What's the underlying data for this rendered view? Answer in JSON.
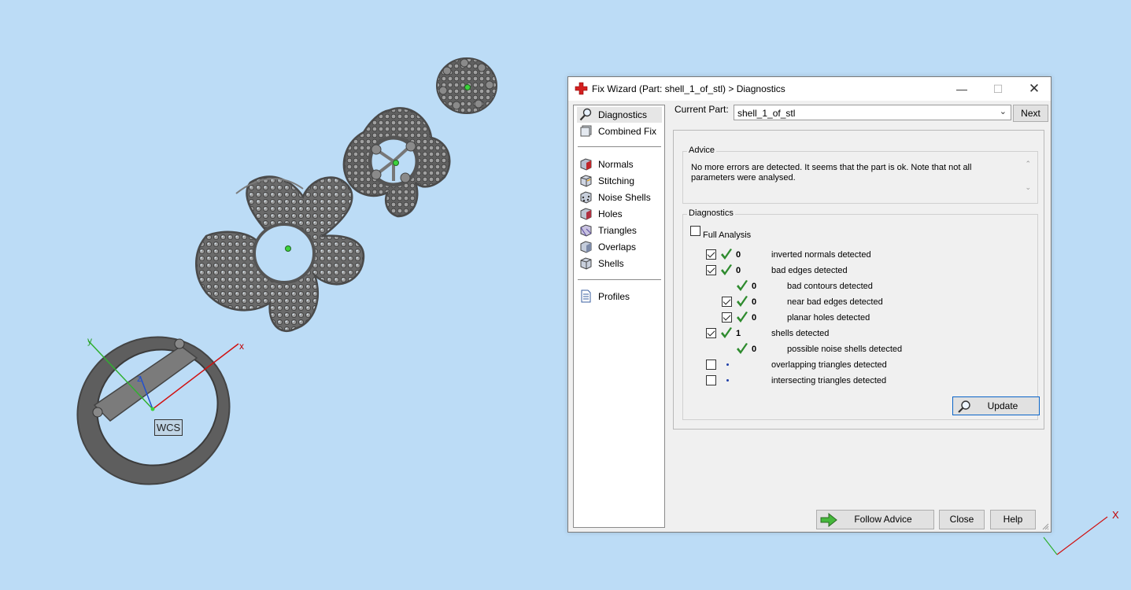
{
  "viewport": {
    "wcs_label": "WCS",
    "axis_x": "x",
    "axis_y": "y",
    "axis_z": "z",
    "corner_axis_x": "X"
  },
  "dialog": {
    "title": "Fix Wizard (Part: shell_1_of_stl) > Diagnostics",
    "window_controls": {
      "minimize": "—",
      "maximize": "☐",
      "close": "✕"
    },
    "nav": {
      "items": [
        {
          "label": "Diagnostics",
          "icon": "magnifier-icon",
          "selected": true
        },
        {
          "label": "Combined Fix",
          "icon": "combined-fix-icon"
        },
        {
          "label": "Normals",
          "icon": "normals-cube-icon"
        },
        {
          "label": "Stitching",
          "icon": "stitching-cube-icon"
        },
        {
          "label": "Noise Shells",
          "icon": "noise-shells-icon"
        },
        {
          "label": "Holes",
          "icon": "holes-cube-icon"
        },
        {
          "label": "Triangles",
          "icon": "triangles-cube-icon"
        },
        {
          "label": "Overlaps",
          "icon": "overlaps-cube-icon"
        },
        {
          "label": "Shells",
          "icon": "shells-cube-icon"
        },
        {
          "label": "Profiles",
          "icon": "profiles-document-icon"
        }
      ]
    },
    "current_part": {
      "label": "Current Part:",
      "value": "shell_1_of_stl"
    },
    "next_label": "Next",
    "advice": {
      "title": "Advice",
      "text": "No more errors are detected. It seems that the part is ok. Note that not all parameters were analysed."
    },
    "diagnostics": {
      "title": "Diagnostics",
      "full_analysis_label": "Full Analysis",
      "full_analysis_checked": false,
      "rows": [
        {
          "checkbox": true,
          "checked": true,
          "status": "ok",
          "count": "0",
          "label": "inverted normals detected",
          "indent": 0
        },
        {
          "checkbox": true,
          "checked": true,
          "status": "ok",
          "count": "0",
          "label": "bad edges detected",
          "indent": 0
        },
        {
          "checkbox": false,
          "checked": false,
          "status": "ok",
          "count": "0",
          "label": "bad contours detected",
          "indent": 1
        },
        {
          "checkbox": true,
          "checked": true,
          "status": "ok",
          "count": "0",
          "label": "near bad edges detected",
          "indent": 1
        },
        {
          "checkbox": true,
          "checked": true,
          "status": "ok",
          "count": "0",
          "label": "planar holes detected",
          "indent": 1
        },
        {
          "checkbox": true,
          "checked": true,
          "status": "ok",
          "count": "1",
          "label": "shells detected",
          "indent": 0
        },
        {
          "checkbox": false,
          "checked": false,
          "status": "ok",
          "count": "0",
          "label": "possible noise shells detected",
          "indent": 1
        },
        {
          "checkbox": true,
          "checked": false,
          "status": "unknown",
          "count": "",
          "label": "overlapping triangles detected",
          "indent": 0
        },
        {
          "checkbox": true,
          "checked": false,
          "status": "unknown",
          "count": "",
          "label": "intersecting triangles detected",
          "indent": 0
        }
      ],
      "update_label": "Update"
    },
    "follow_advice_label": "Follow Advice",
    "close_label": "Close",
    "help_label": "Help",
    "colors": {
      "check_green": "#2e8b2e",
      "accent_blue": "#0a64c8",
      "title_icon_red": "#d32020"
    }
  }
}
